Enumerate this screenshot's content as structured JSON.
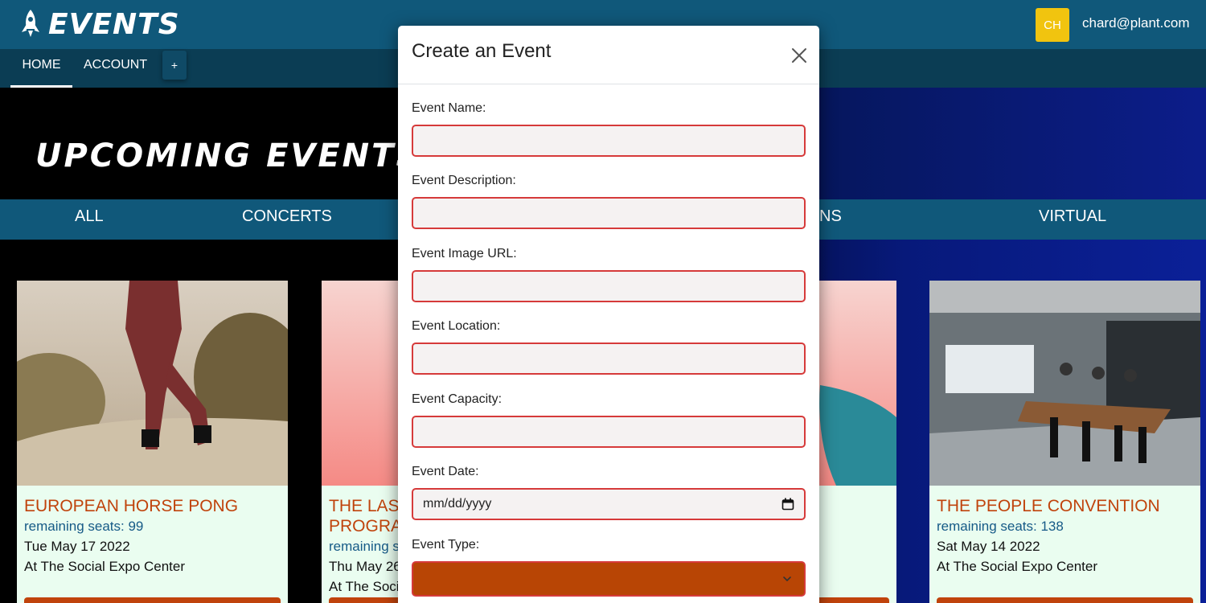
{
  "header": {
    "logo_text": "EVENTS",
    "avatar_initials": "CH",
    "user_email": "chard@plant.com"
  },
  "nav": {
    "home": "HOME",
    "account": "ACCOUNT",
    "plus": "+"
  },
  "hero": {
    "title": "upcoming events"
  },
  "categories": [
    "ALL",
    "CONCERTS",
    "NS",
    "VIRTUAL"
  ],
  "cards": [
    {
      "title": "EUROPEAN HORSE PONG",
      "seats": "remaining seats: 99",
      "date": "Tue May 17 2022",
      "location": "At The Social Expo Center"
    },
    {
      "title_line1": "THE LAST",
      "title_line2": "PROGRA",
      "seats": "remaining s",
      "date": "Thu May 26",
      "location": "At The Soci"
    },
    {
      "title": "THE PEOPLE CONVENTION",
      "seats": "remaining seats: 138",
      "date": "Sat May 14 2022",
      "location": "At The Social Expo Center"
    }
  ],
  "modal": {
    "title": "Create an Event",
    "fields": [
      {
        "label": "Event Name:",
        "value": ""
      },
      {
        "label": "Event Description:",
        "value": ""
      },
      {
        "label": "Event Image URL:",
        "value": ""
      },
      {
        "label": "Event Location:",
        "value": ""
      },
      {
        "label": "Event Capacity:",
        "value": ""
      },
      {
        "label": "Event Date:",
        "value": "mm/dd/yyyy"
      },
      {
        "label": "Event Type:",
        "value": ""
      }
    ]
  },
  "colors": {
    "header_bg": "#10587a",
    "nav_bg": "#0b3d54",
    "accent_orange": "#c0430c",
    "error_border": "#d63a3a",
    "avatar_bg": "#f1c40f"
  }
}
